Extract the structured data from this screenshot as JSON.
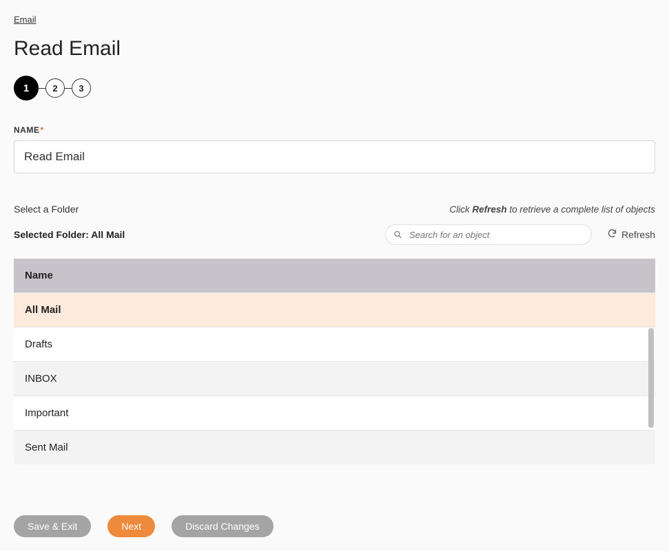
{
  "breadcrumb": {
    "label": "Email"
  },
  "page_title": "Read Email",
  "stepper": {
    "steps": [
      "1",
      "2",
      "3"
    ],
    "active_index": 0
  },
  "name_field": {
    "label": "NAME",
    "required_marker": "*",
    "value": "Read Email"
  },
  "folder_section": {
    "select_label": "Select a Folder",
    "hint_prefix": "Click ",
    "hint_bold": "Refresh",
    "hint_suffix": " to retrieve a complete list of objects",
    "selected_prefix": "Selected Folder: ",
    "selected_value": "All Mail",
    "search_placeholder": "Search for an object",
    "refresh_label": "Refresh",
    "table_header": "Name",
    "rows": [
      {
        "name": "All Mail",
        "selected": true
      },
      {
        "name": "Drafts",
        "selected": false
      },
      {
        "name": "INBOX",
        "selected": false
      },
      {
        "name": "Important",
        "selected": false
      },
      {
        "name": "Sent Mail",
        "selected": false
      }
    ]
  },
  "footer": {
    "save_exit": "Save & Exit",
    "next": "Next",
    "discard": "Discard Changes"
  }
}
